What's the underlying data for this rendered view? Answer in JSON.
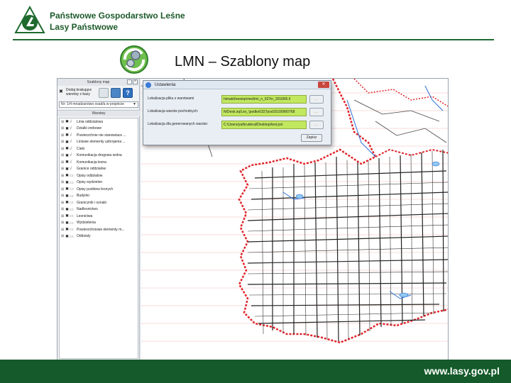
{
  "header": {
    "org_line1": "Państwowe Gospodarstwo Leśne",
    "org_line2": "Lasy Państwowe",
    "title": "LMN – Szablony map"
  },
  "panel": {
    "title": "Szablony map",
    "label": "Dodaj brakujące warstwy z bazy",
    "select_value": "Nr: 1/4 mnadzarstwo osad/a w projekcie",
    "layers_title": "Warstwy",
    "layers": [
      "Linia oddzialowa",
      "Dzialki zrebowe",
      "Powierzchnie nie stanowiace ...",
      "Liniowe elementy uzbrojenia ...",
      "Cieki",
      "Komunikacja drogowa wolna",
      "Komunikacja lesna",
      "Granice oddzialow",
      "Opisy oddzialow",
      "Opisy wydzielen",
      "Opisy punktow lesnych",
      "Budynki",
      "Granicznik i oznaki",
      "Nadlesnictwo",
      "Lesnictwa",
      "Wydzielenia",
      "Powierzchniowe elementy m...",
      "Oddzialy"
    ]
  },
  "dialog": {
    "title": "Ustawienia",
    "rows": [
      {
        "label": "Lokalizacja pliku z warstwami",
        "value": "himakil/sestop\\med\\mi_n_027in_2016R6.ll"
      },
      {
        "label": "Lokalizacja warstw pochodnych:",
        "value": "N/Desk.sq/Les_\\podkn0327pod15100960768"
      },
      {
        "label": "Lokalizacja dla generowanych warstw:",
        "value": "C:\\Users/ya/bruderal/Desktop/test.pst"
      }
    ],
    "browse_label": "...",
    "save_label": "Zapisz"
  },
  "footer": {
    "url": "www.lasy.gov.pl"
  },
  "colors": {
    "brand_green": "#145a2a",
    "field_green": "#c2e85f",
    "map_red": "#e0242a"
  },
  "icons": {
    "logo": "lasy-panstwowe-logo",
    "title_icon": "recycle-gear-icon",
    "close": "close-icon",
    "folder": "folder-icon",
    "help": "help-icon",
    "gear": "gear-icon"
  }
}
